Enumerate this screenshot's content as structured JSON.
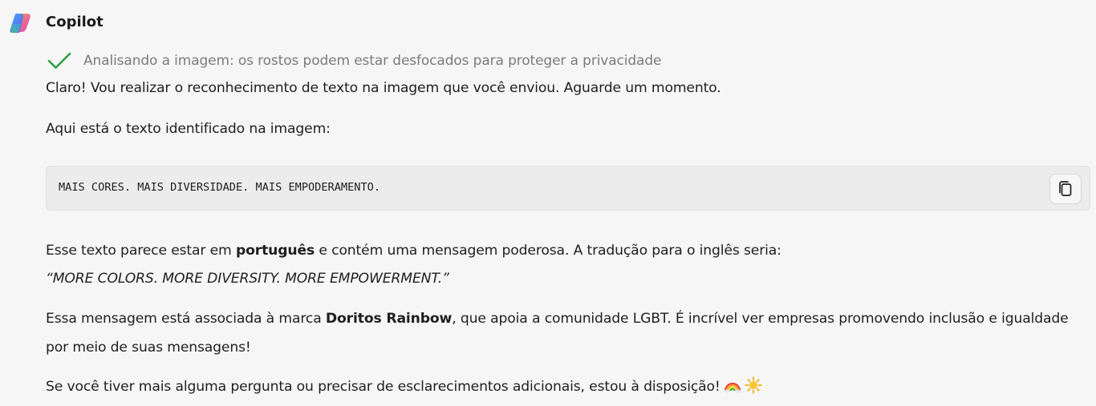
{
  "header": {
    "sender_name": "Copilot",
    "avatar_icon": "copilot-logo-icon"
  },
  "status": {
    "icon": "checkmark-icon",
    "icon_color": "#2e9e3e",
    "text": "Analisando a imagem: os rostos podem estar desfocados para proteger a privacidade"
  },
  "message": {
    "p1": "Claro! Vou realizar o reconhecimento de texto na imagem que você enviou. Aguarde um momento.",
    "p2": "Aqui está o texto identificado na imagem:",
    "code": {
      "text": "MAIS CORES. MAIS DIVERSIDADE. MAIS EMPODERAMENTO.",
      "copy_icon": "copy-icon"
    },
    "p3": {
      "before": "Esse texto parece estar em ",
      "bold": "português",
      "after": " e contém uma mensagem poderosa. A tradução para o inglês seria:"
    },
    "translation": "“MORE COLORS. MORE DIVERSITY. MORE EMPOWERMENT.”",
    "p4": {
      "before": "Essa mensagem está associada à marca ",
      "bold": "Doritos Rainbow",
      "after": ", que apoia a comunidade LGBT. É incrível ver empresas promovendo inclusão e igualdade",
      "line2": "por meio de suas mensagens!"
    },
    "p5": {
      "text": "Se você tiver mais alguma pergunta ou precisar de esclarecimentos adicionais, estou à disposição!",
      "emoji_1": "rainbow-emoji",
      "emoji_2": "sun-emoji"
    }
  }
}
